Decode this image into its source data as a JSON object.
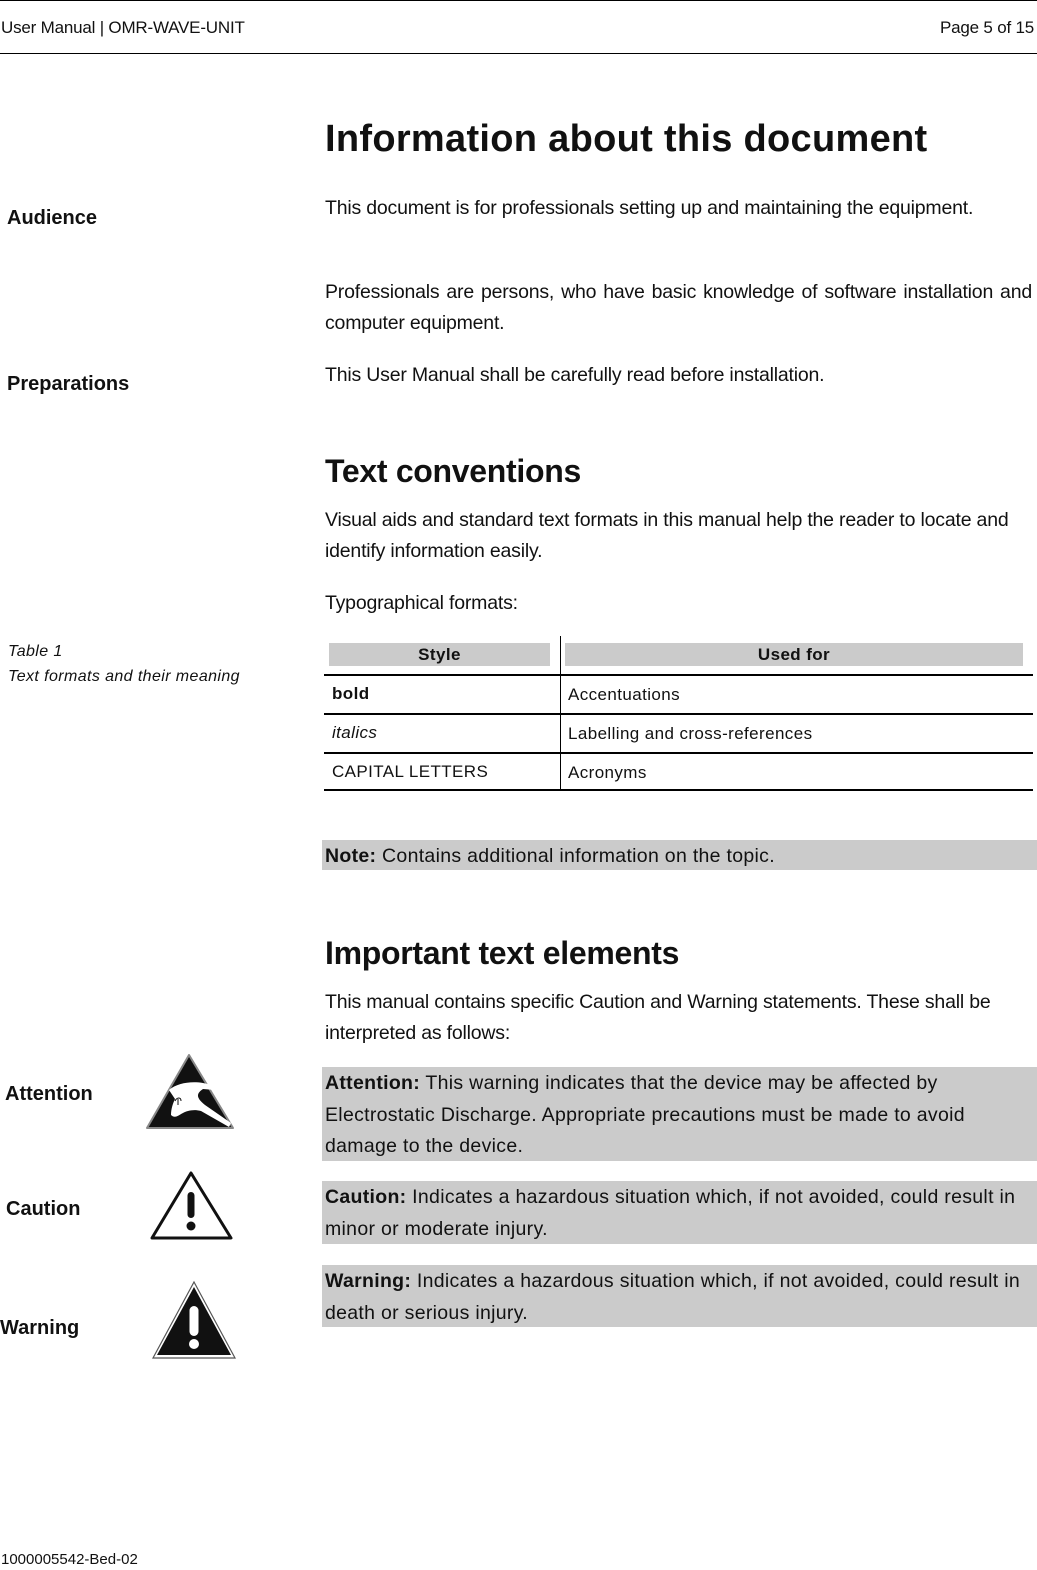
{
  "header": {
    "left": "User Manual | OMR-WAVE-UNIT",
    "right": "Page 5 of 15"
  },
  "title": "Information about this document",
  "sidebar": {
    "audience": "Audience",
    "preparations": "Preparations",
    "table_caption_line1": "Table 1",
    "table_caption_line2": "Text formats and their meaning",
    "attention": "Attention",
    "caution": "Caution",
    "warning": "Warning"
  },
  "audience": {
    "paragraph1": "This document is for professionals setting up and maintaining the equipment.",
    "paragraph2": "Professionals are persons, who have basic knowledge of software installation and computer equipment."
  },
  "preparations": {
    "paragraph": "This User Manual shall be carefully read before installation."
  },
  "text_conventions": {
    "heading": "Text conventions",
    "paragraph": "Visual aids and standard text formats in this manual help the reader to locate and identify information easily.",
    "typo_label": "Typographical formats:",
    "table": {
      "headers": [
        "Style",
        "Used for"
      ],
      "rows": [
        {
          "style": "bold",
          "used_for": "Accentuations"
        },
        {
          "style": "italics",
          "used_for": "Labelling and cross-references"
        },
        {
          "style": "CAPITAL LETTERS",
          "used_for": "Acronyms"
        }
      ]
    },
    "note": {
      "label": "Note:",
      "text": " Contains additional information on the topic."
    }
  },
  "important": {
    "heading": "Important text elements",
    "paragraph": "This manual contains specific Caution and Warning statements. These shall be interpreted as follows:",
    "attention": {
      "icon": "esd-warning-icon",
      "label": "Attention:",
      "text": " This warning indicates that the device may be affected by Electrostatic Discharge. Appropriate precautions must be made to avoid damage to the device."
    },
    "caution": {
      "icon": "caution-triangle-icon",
      "label": "Caution:",
      "text": " Indicates a hazardous situation which, if not avoided, could result in minor or moderate injury."
    },
    "warning": {
      "icon": "warning-triangle-icon",
      "label": "Warning:",
      "text": " Indicates a hazardous situation which, if not avoided, could result in death or serious injury."
    }
  },
  "colors": {
    "highlight_box": "#cbcbcb",
    "text": "#111111"
  },
  "footer": {
    "doc_id": "1000005542-Bed-02"
  }
}
